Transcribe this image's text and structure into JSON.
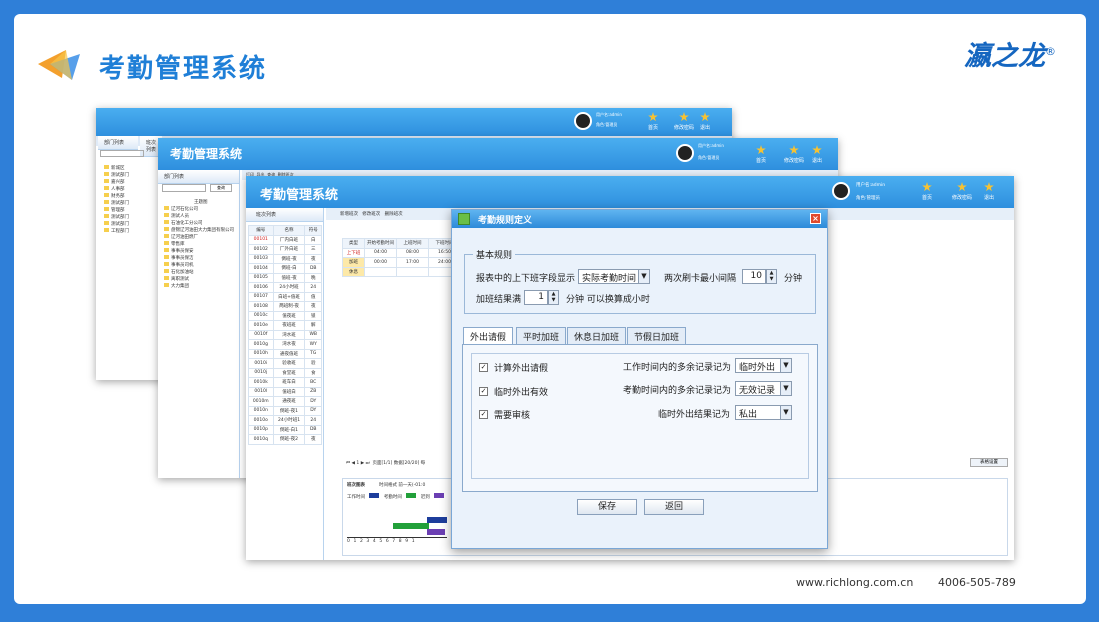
{
  "slide": {
    "title": "考勤管理系统",
    "brand": "瀛之龙",
    "brand_mark": "®",
    "url": "www.richlong.com.cn",
    "phone": "4006-505-789"
  },
  "back_window": {
    "user_label": "用户名:admin",
    "role_label": "角色:管理员",
    "buttons": [
      "首页",
      "修改密码",
      "退出"
    ],
    "side_tabs": [
      "部门列表",
      "班次列表"
    ],
    "search_label": "查询",
    "tree": [
      "新城区",
      "测试部门",
      "嘉兴部",
      "人事部",
      "财务部",
      "测试部门",
      "管理部",
      "测试部门",
      "测试部门",
      "工程部门"
    ]
  },
  "mid_window": {
    "title": "考勤管理系统",
    "user_label": "用户名:admin",
    "role_label": "角色:管理员",
    "buttons": [
      "首页",
      "修改密码",
      "退出"
    ],
    "side_tab": "部门列表",
    "search_label": "查询",
    "tree_root": "王题图",
    "tree": [
      "辽河石化公司",
      "测试人员",
      "石油化工分公司",
      "盘锦辽河油田大力集团有限公司",
      "辽河油田燃厂",
      "零售库",
      "事事员保安",
      "事事员保洁",
      "事事员司机",
      "石化加油站",
      "离职测试",
      "大力集团"
    ],
    "toolbar": [
      "打印",
      "导出",
      "查询",
      "删除班次"
    ]
  },
  "front_window": {
    "title": "考勤管理系统",
    "user_label": "用户名:admin",
    "role_label": "角色:管理员",
    "buttons": [
      "首页",
      "修改密码",
      "退出"
    ],
    "side_tab": "班次列表",
    "toolbar": [
      "新增班次",
      "修改班次",
      "删除班次"
    ],
    "shift_headers": [
      "编号",
      "名称",
      "符号"
    ],
    "shifts": [
      [
        "00101",
        "厂内白班",
        "白"
      ],
      [
        "00102",
        "厂外白班",
        "三"
      ],
      [
        "00103",
        "倒班-夜",
        "夜"
      ],
      [
        "00104",
        "倒班-白",
        "DB"
      ],
      [
        "00105",
        "值班-夜",
        "晚"
      ],
      [
        "00106",
        "24小时班",
        "24"
      ],
      [
        "00107",
        "白班+值班",
        "值"
      ],
      [
        "00108",
        "两班制-夜",
        "夜"
      ],
      [
        "0010c",
        "值夜班",
        "锁"
      ],
      [
        "0010e",
        "夜班班",
        "解"
      ],
      [
        "0010f",
        "湾水班",
        "WB"
      ],
      [
        "0010g",
        "湾水夜",
        "WY"
      ],
      [
        "0010h",
        "通夜值班",
        "TG"
      ],
      [
        "0010i",
        "验收班",
        "验"
      ],
      [
        "0010j",
        "食堂班",
        "食"
      ],
      [
        "0010k",
        "班车白",
        "BC"
      ],
      [
        "0010l",
        "值班白",
        "ZB"
      ],
      [
        "0010m",
        "通夜班",
        "DY"
      ],
      [
        "0010n",
        "倒班-夜1",
        "DY"
      ],
      [
        "0010o",
        "24小时班1",
        "24"
      ],
      [
        "0010p",
        "倒班-白1",
        "DB"
      ],
      [
        "0010q",
        "倒班-夜2",
        "夜"
      ]
    ],
    "time_headers": [
      "类型",
      "开始考勤时间",
      "上班时间",
      "下班时间"
    ],
    "time_rows": [
      [
        "上下班",
        "04:00",
        "08:00",
        "16:50"
      ],
      [
        "加班",
        "00:00",
        "17:00",
        "24:00"
      ],
      [
        "休息",
        "",
        "",
        ""
      ]
    ],
    "pager": "页面[1/1]  数据[20/20]  每",
    "right_btn": "表格设置",
    "bottom_tab": "班次图表",
    "bottom_info": "时间格式  前一天(-01:0",
    "legend": [
      "工作时间",
      "考勤时间",
      "迟到"
    ],
    "axis": [
      "0",
      "1",
      "2",
      "3",
      "4",
      "5",
      "6",
      "7",
      "8",
      "9",
      "1"
    ]
  },
  "dialog": {
    "title": "考勤规则定义",
    "basic_legend": "基本规则",
    "show_label": "报表中的上下班字段显示",
    "show_value": "实际考勤时间",
    "interval_label": "两次刷卡最小间隔",
    "interval_value": "10",
    "interval_unit": "分钟",
    "overtime_label": "加班结果满",
    "overtime_value": "1",
    "overtime_unit": "分钟 可以换算成小时",
    "tabs": [
      "外出请假",
      "平时加班",
      "休息日加班",
      "节假日加班"
    ],
    "checks": [
      {
        "label": "计算外出请假",
        "checked": true
      },
      {
        "label": "临时外出有效",
        "checked": true
      },
      {
        "label": "需要审核",
        "checked": true
      }
    ],
    "right_rows": [
      {
        "label": "工作时间内的多余记录记为",
        "value": "临时外出"
      },
      {
        "label": "考勤时间内的多余记录记为",
        "value": "无效记录"
      },
      {
        "label": "临时外出结果记为",
        "value": "私出"
      }
    ],
    "save": "保存",
    "back": "返回"
  }
}
